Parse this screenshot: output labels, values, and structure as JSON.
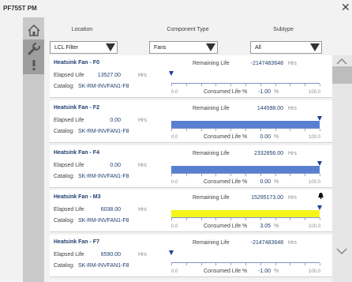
{
  "window": {
    "title": "PF755T PM",
    "close_glyph": "✕"
  },
  "sidebar": {
    "icons": [
      "home-icon",
      "wrench-icon",
      "alert-icon"
    ]
  },
  "filters": {
    "location": {
      "label": "Location",
      "value": "LCL Filter"
    },
    "component_type": {
      "label": "Component Type",
      "value": "Fans"
    },
    "subtype": {
      "label": "Subtype",
      "value": "All"
    }
  },
  "labels": {
    "remaining_life": "Remaining Life",
    "elapsed_life": "Elapsed Life",
    "catalog": "Catalog:",
    "consumed_life": "Consumed Life %",
    "hrs": "Hrs",
    "percent": "%",
    "scale_min": "0.0",
    "scale_max": "100.0"
  },
  "items": [
    {
      "name": "Heatsink Fan - F0",
      "remaining": "-2147483648",
      "elapsed": "13527.00",
      "catalog": "SK-RM-INVFAN1-F8",
      "consumed": "-1.00",
      "consumed_fraction": 0,
      "bar_color": "#5a7fd1",
      "alarm": false
    },
    {
      "name": "Heatsink Fan - F2",
      "remaining": "144598.00",
      "elapsed": "0.00",
      "catalog": "SK-RM-INVFAN1-F8",
      "consumed": "0.00",
      "consumed_fraction": 1,
      "bar_color": "#5a7fd1",
      "alarm": false
    },
    {
      "name": "Heatsink Fan - F4",
      "remaining": "2332856.00",
      "elapsed": "0.00",
      "catalog": "SK-RM-INVFAN1-F8",
      "consumed": "0.00",
      "consumed_fraction": 1,
      "bar_color": "#5a7fd1",
      "alarm": false
    },
    {
      "name": "Heatsink Fan - M3",
      "remaining": "15295173.00",
      "elapsed": "6038.00",
      "catalog": "SK-RM-INVFAN1-F8",
      "consumed": "3.05",
      "consumed_fraction": 1,
      "bar_color": "#f5f51a",
      "alarm": true
    },
    {
      "name": "Heatsink Fan - F7",
      "remaining": "-2147483648",
      "elapsed": "6590.00",
      "catalog": "SK-RM-INVFAN1-F8",
      "consumed": "-1.00",
      "consumed_fraction": 0,
      "bar_color": "#5a7fd1",
      "alarm": false
    }
  ]
}
